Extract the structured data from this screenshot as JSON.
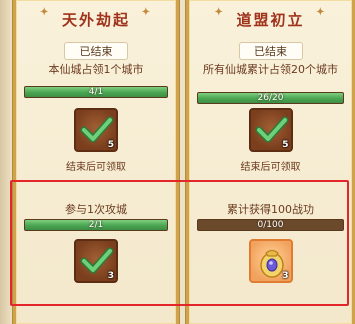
{
  "left_panel": {
    "title": "天外劫起",
    "status": "已结束",
    "task1": {
      "desc": "本仙城占领1个城市",
      "progress_text": "4/1",
      "progress": 1.0,
      "item_count": "5",
      "note": "结束后可领取"
    },
    "task2": {
      "desc": "参与1次攻城",
      "progress_text": "2/1",
      "progress": 1.0,
      "item_count": "3"
    }
  },
  "right_panel": {
    "title": "道盟初立",
    "status": "已结束",
    "task1": {
      "desc": "所有仙城累计占领20个城市",
      "progress_text": "26/20",
      "progress": 1.0,
      "item_count": "5",
      "note": "结束后可领取"
    },
    "task2": {
      "desc": "累计获得100战功",
      "progress_text": "0/100",
      "progress": 0.0,
      "item_count": "3"
    }
  },
  "icons": [
    "checkmark-icon",
    "treasure-bag-icon"
  ],
  "colors": {
    "title": "#a0321c",
    "progress_green": "#4aa552",
    "progress_track": "#6b4a2c",
    "highlight_red": "#e2262a",
    "panel_border": "#cfa24c"
  }
}
